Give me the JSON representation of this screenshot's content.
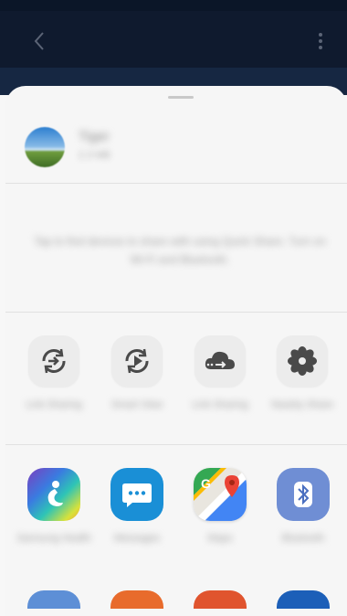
{
  "colors": {
    "app_bar": "#0f1a2e",
    "sheet_bg": "#f6f6f6",
    "quick_action_icon": "#4a4a4a"
  },
  "header": {
    "back_icon": "chevron-left-icon",
    "more_icon": "more-vertical-icon"
  },
  "share_sheet": {
    "file": {
      "name": "Tiger",
      "meta": "2.3 MB"
    },
    "nearby_hint": "Tap to find devices to share with using Quick Share. Turn on Wi-Fi and Bluetooth.",
    "quick_actions": [
      {
        "icon": "link-sharing-icon",
        "label": "Link Sharing"
      },
      {
        "icon": "smart-view-icon",
        "label": "Smart View"
      },
      {
        "icon": "cloud-share-icon",
        "label": "Link Sharing"
      },
      {
        "icon": "flower-icon",
        "label": "Nearby Share"
      }
    ],
    "apps": [
      {
        "icon": "health-app-icon",
        "label": "Samsung Health"
      },
      {
        "icon": "messages-app-icon",
        "label": "Messages"
      },
      {
        "icon": "maps-app-icon",
        "label": "Maps"
      },
      {
        "icon": "bluetooth-app-icon",
        "label": "Bluetooth"
      }
    ]
  }
}
